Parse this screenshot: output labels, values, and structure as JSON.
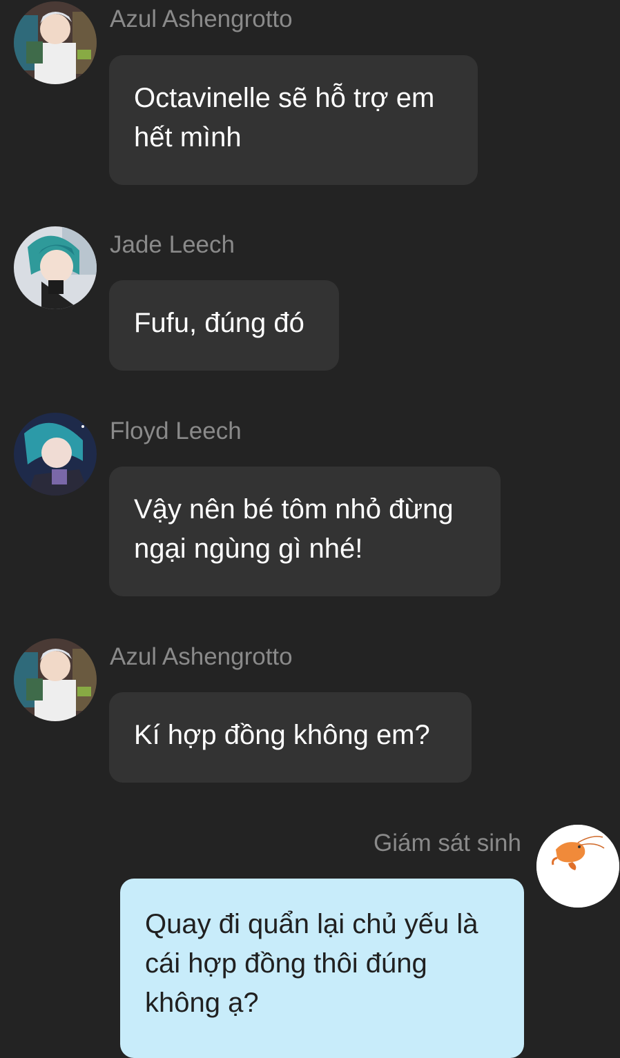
{
  "messages": [
    {
      "sender": "Azul Ashengrotto",
      "avatar": "azul-avatar",
      "text": "Octavinelle sẽ hỗ trợ em hết mình",
      "own": false
    },
    {
      "sender": "Jade Leech",
      "avatar": "jade-avatar",
      "text": "Fufu, đúng đó",
      "own": false
    },
    {
      "sender": "Floyd Leech",
      "avatar": "floyd-avatar",
      "text": "Vậy nên bé tôm nhỏ đừng ngại ngùng gì nhé!",
      "own": false
    },
    {
      "sender": "Azul Ashengrotto",
      "avatar": "azul-avatar",
      "text": "Kí hợp đồng không em?",
      "own": false
    },
    {
      "sender": "Giám sát sinh",
      "avatar": "shrimp-avatar",
      "text": "Quay đi quẩn lại chủ yếu là cái hợp đồng thôi đúng không ạ?",
      "own": true
    }
  ],
  "colors": {
    "background": "#232323",
    "bubble_other": "#333333",
    "bubble_own": "#c8ecfa",
    "sender_text": "#8a8a8a"
  }
}
